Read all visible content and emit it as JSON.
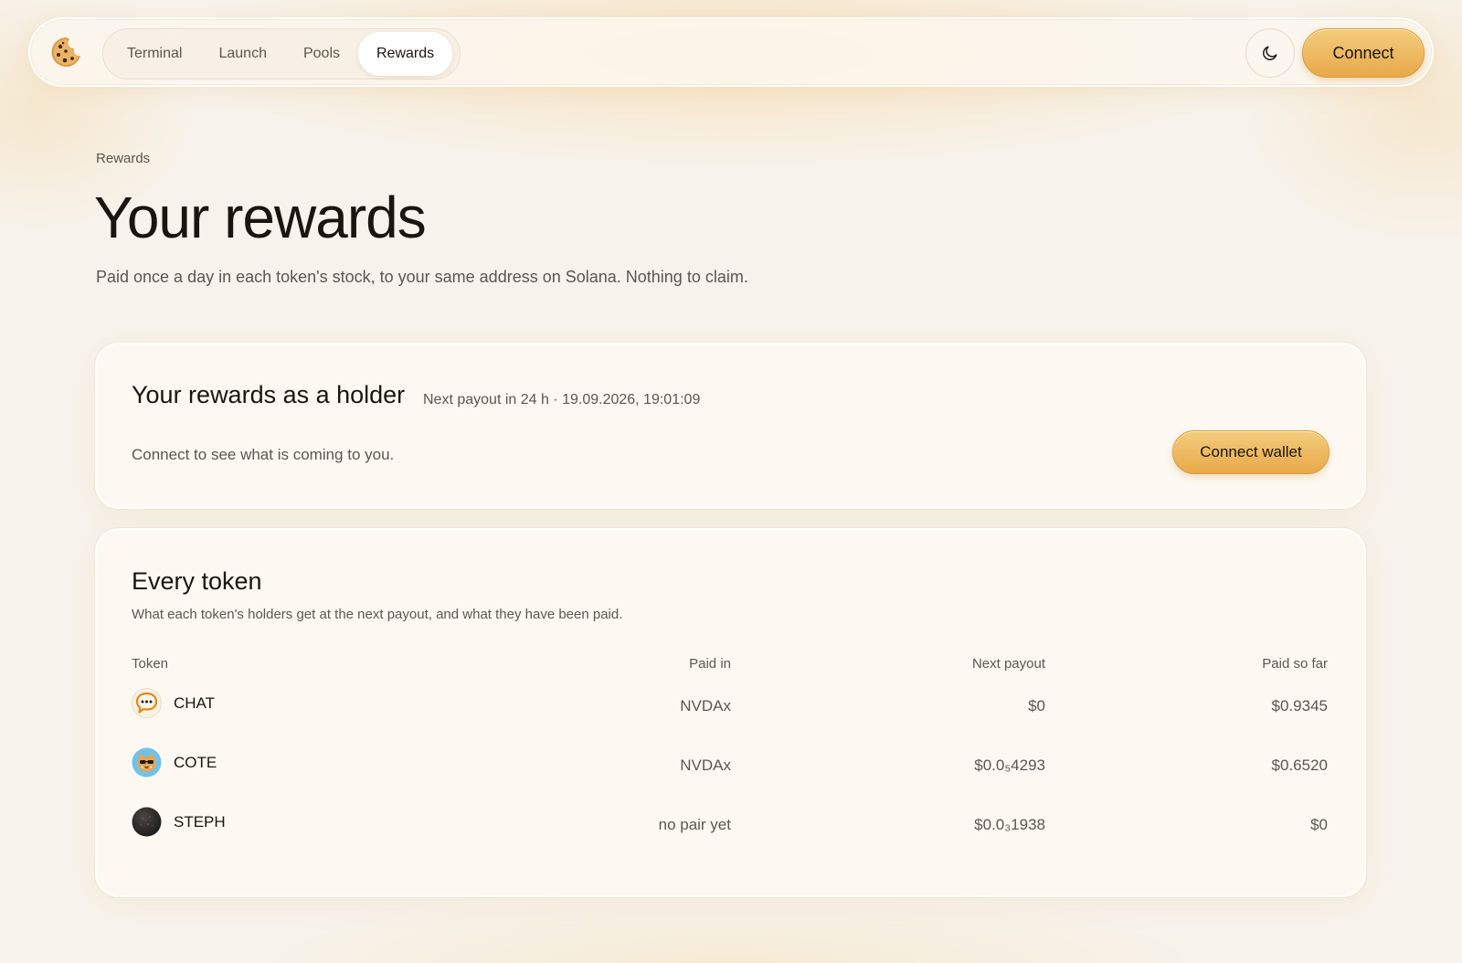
{
  "nav": {
    "items": [
      {
        "label": "Terminal",
        "active": false
      },
      {
        "label": "Launch",
        "active": false
      },
      {
        "label": "Pools",
        "active": false
      },
      {
        "label": "Rewards",
        "active": true
      }
    ],
    "theme_icon": "moon-icon",
    "connect_label": "Connect"
  },
  "header": {
    "breadcrumb": "Rewards",
    "title": "Your rewards",
    "subtitle": "Paid once a day in each token's stock, to your same address on Solana. Nothing to claim."
  },
  "holder": {
    "title": "Your rewards as a holder",
    "next_payout": "Next payout in 24 h · 19.09.2026, 19:01:09",
    "description": "Connect to see what is coming to you.",
    "button_label": "Connect wallet"
  },
  "tokens": {
    "title": "Every token",
    "description": "What each token's holders get at the next payout, and what they have been paid.",
    "columns": [
      "Token",
      "Paid in",
      "Next payout",
      "Paid so far"
    ],
    "rows": [
      {
        "name": "CHAT",
        "icon": "chat-bubble-icon",
        "paid_in": "NVDAx",
        "next_payout": "$0",
        "paid_so_far": "$0.9345"
      },
      {
        "name": "COTE",
        "icon": "cat-icon",
        "paid_in": "NVDAx",
        "next_payout": "$0.0₅4293",
        "paid_so_far": "$0.6520"
      },
      {
        "name": "STEPH",
        "icon": "dark-token-icon",
        "paid_in": "no pair yet",
        "next_payout": "$0.0₃1938",
        "paid_so_far": "$0"
      }
    ]
  },
  "colors": {
    "accent": "#e8a94a",
    "background": "#f7f3ec",
    "card": "#fdf9f2"
  }
}
